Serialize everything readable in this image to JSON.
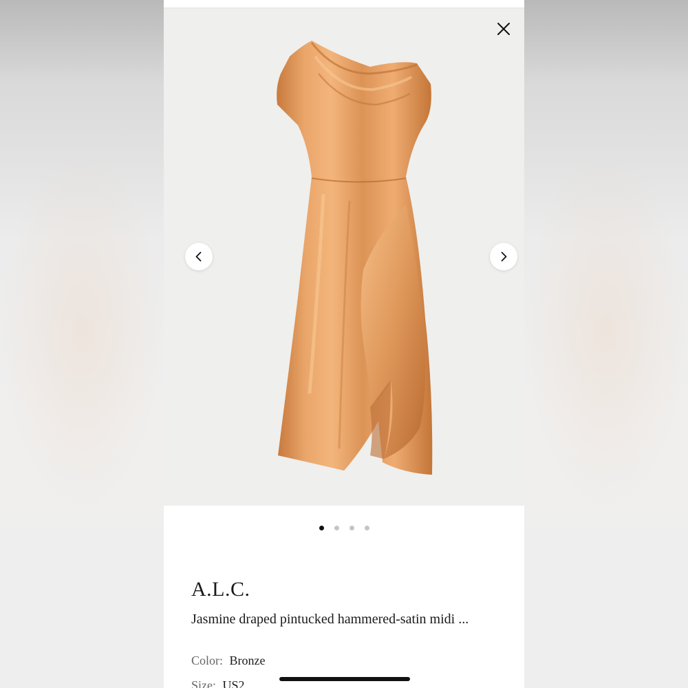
{
  "product": {
    "brand": "A.L.C.",
    "name": "Jasmine draped pintucked hammered-satin midi ...",
    "color_label": "Color:",
    "color_value": "Bronze",
    "size_label": "Size:",
    "size_value": "US2"
  },
  "gallery": {
    "image_count": 4,
    "active_index": 0
  },
  "icons": {
    "close": "close-icon",
    "prev": "chevron-left-icon",
    "next": "chevron-right-icon"
  },
  "colors": {
    "dress": "#e0995a",
    "gallery_bg": "#efefed",
    "active_dot": "#111111",
    "inactive_dot": "#c4c4c4"
  }
}
